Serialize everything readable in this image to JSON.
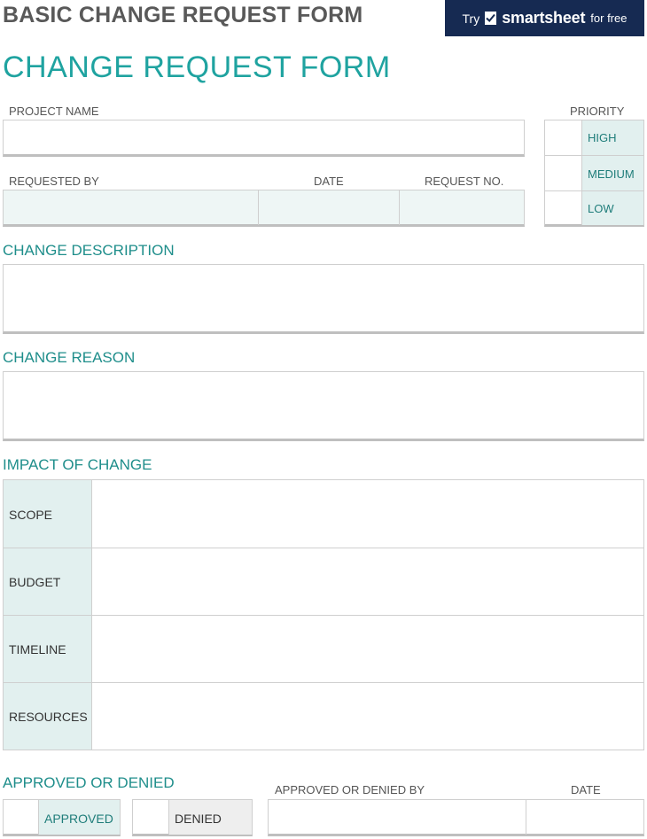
{
  "header": {
    "doc_title": "BASIC CHANGE REQUEST FORM",
    "banner": {
      "try": "Try",
      "brand": "smartsheet",
      "free": "for free"
    },
    "form_title": "CHANGE REQUEST FORM"
  },
  "fields": {
    "project_name": "PROJECT NAME",
    "requested_by": "REQUESTED BY",
    "date": "DATE",
    "request_no": "REQUEST NO."
  },
  "priority": {
    "label": "PRIORITY",
    "options": [
      "HIGH",
      "MEDIUM",
      "LOW"
    ]
  },
  "sections": {
    "change_description": "CHANGE DESCRIPTION",
    "change_reason": "CHANGE REASON",
    "impact_of_change": "IMPACT OF CHANGE",
    "approved_or_denied": "APPROVED OR DENIED"
  },
  "impact_rows": [
    "SCOPE",
    "BUDGET",
    "TIMELINE",
    "RESOURCES"
  ],
  "approval": {
    "approved": "APPROVED",
    "denied": "DENIED",
    "by_label": "APPROVED OR DENIED BY",
    "date_label": "DATE"
  },
  "colors": {
    "accent": "#1fa3a0",
    "banner": "#162a52",
    "tint": "#eef6f5"
  }
}
